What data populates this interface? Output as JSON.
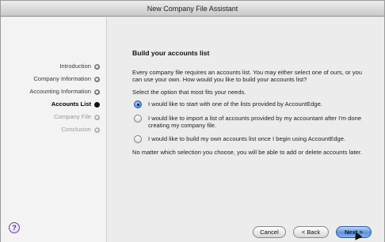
{
  "window": {
    "title": "New Company File Assistant"
  },
  "sidebar": {
    "steps": [
      {
        "label": "Introduction",
        "state": "done"
      },
      {
        "label": "Company Information",
        "state": "done"
      },
      {
        "label": "Accounting Information",
        "state": "done"
      },
      {
        "label": "Accounts List",
        "state": "current"
      },
      {
        "label": "Company File",
        "state": "pending"
      },
      {
        "label": "Conclusion",
        "state": "pending"
      }
    ]
  },
  "main": {
    "heading": "Build your accounts list",
    "intro": "Every company file requires an accounts list.  You may either select one of ours, or you can use your own.  How would you like to build your accounts list?",
    "prompt": "Select the option that most fits your needs.",
    "options": [
      {
        "label": "I would like to start with one of the lists provided by AccountEdge.",
        "selected": true
      },
      {
        "label": "I would like to import a list of accounts provided by my accountant after I'm done creating my company file.",
        "selected": false
      },
      {
        "label": "I would like to build my own accounts list once I begin using AccountEdge.",
        "selected": false
      }
    ],
    "note": "No matter which selection you choose, you will be able to add or delete accounts later."
  },
  "footer": {
    "help_icon": "?",
    "cancel_label": "Cancel",
    "back_label": "< Back",
    "next_label": "Next >"
  }
}
